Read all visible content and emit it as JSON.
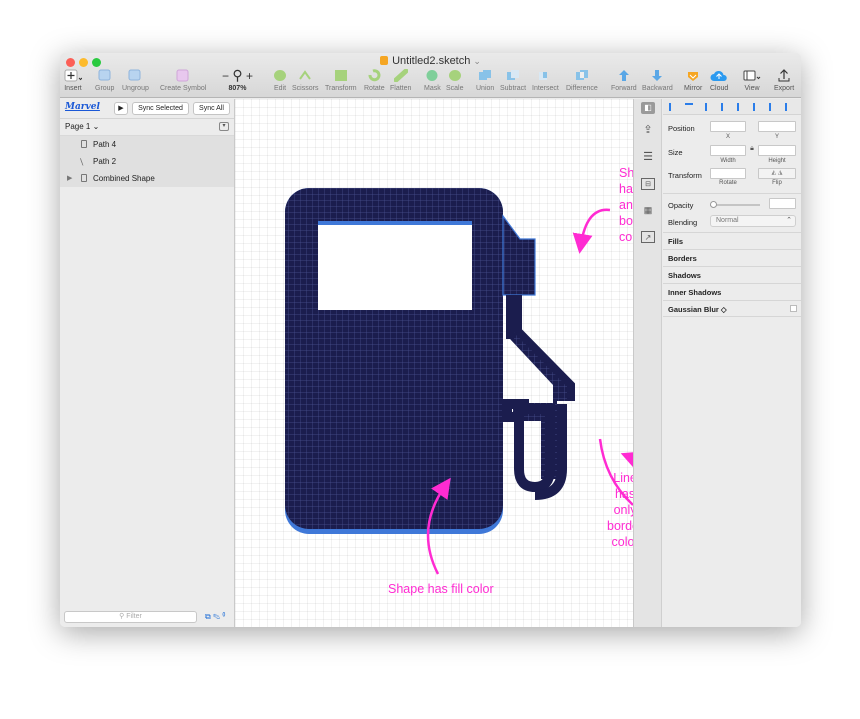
{
  "window": {
    "title": "Untitled2.sketch"
  },
  "toolbar": {
    "items": [
      {
        "label": "Insert",
        "icon": "plus-icon"
      },
      {
        "label": "Group",
        "icon": "group-icon"
      },
      {
        "label": "Ungroup",
        "icon": "ungroup-icon"
      },
      {
        "label": "Create Symbol",
        "icon": "symbol-icon"
      },
      {
        "label": "807%",
        "icon": "zoom-icon"
      },
      {
        "label": "Edit",
        "icon": "edit-icon"
      },
      {
        "label": "Scissors",
        "icon": "scissors-icon"
      },
      {
        "label": "Transform",
        "icon": "transform-icon"
      },
      {
        "label": "Rotate",
        "icon": "rotate-icon"
      },
      {
        "label": "Flatten",
        "icon": "flatten-icon"
      },
      {
        "label": "Mask",
        "icon": "mask-icon"
      },
      {
        "label": "Scale",
        "icon": "scale-icon"
      },
      {
        "label": "Union",
        "icon": "union-icon"
      },
      {
        "label": "Subtract",
        "icon": "subtract-icon"
      },
      {
        "label": "Intersect",
        "icon": "intersect-icon"
      },
      {
        "label": "Difference",
        "icon": "difference-icon"
      },
      {
        "label": "Forward",
        "icon": "forward-icon"
      },
      {
        "label": "Backward",
        "icon": "backward-icon"
      },
      {
        "label": "Mirror",
        "icon": "mirror-icon"
      },
      {
        "label": "Cloud",
        "icon": "cloud-icon"
      },
      {
        "label": "View",
        "icon": "view-icon"
      },
      {
        "label": "Export",
        "icon": "export-icon"
      }
    ]
  },
  "layers": {
    "brand": "Marvel",
    "play": "▶",
    "sync_selected": "Sync Selected",
    "sync_all": "Sync All",
    "page": "Page 1 ⌄",
    "items": [
      {
        "name": "Path 4"
      },
      {
        "name": "Path 2"
      },
      {
        "name": "Combined Shape"
      }
    ],
    "filter_placeholder": "Filter"
  },
  "canvas": {
    "annotations": {
      "top_right": "Shape\nhas fill\nand\nborder\ncolor",
      "bottom_right": "Line has only\nborder color",
      "bottom": "Shape has fill color"
    },
    "colors": {
      "shape_fill": "#1b1d4e",
      "shape_border": "#3f78d8",
      "annotation": "#ff2bd2"
    }
  },
  "inspector": {
    "position": "Position",
    "x": "X",
    "y": "Y",
    "size": "Size",
    "width": "Width",
    "height": "Height",
    "transform": "Transform",
    "rotate": "Rotate",
    "flip": "Flip",
    "opacity": "Opacity",
    "blending": "Blending",
    "blending_value": "Normal",
    "sections": [
      "Fills",
      "Borders",
      "Shadows",
      "Inner Shadows",
      "Gaussian Blur ◇"
    ]
  }
}
